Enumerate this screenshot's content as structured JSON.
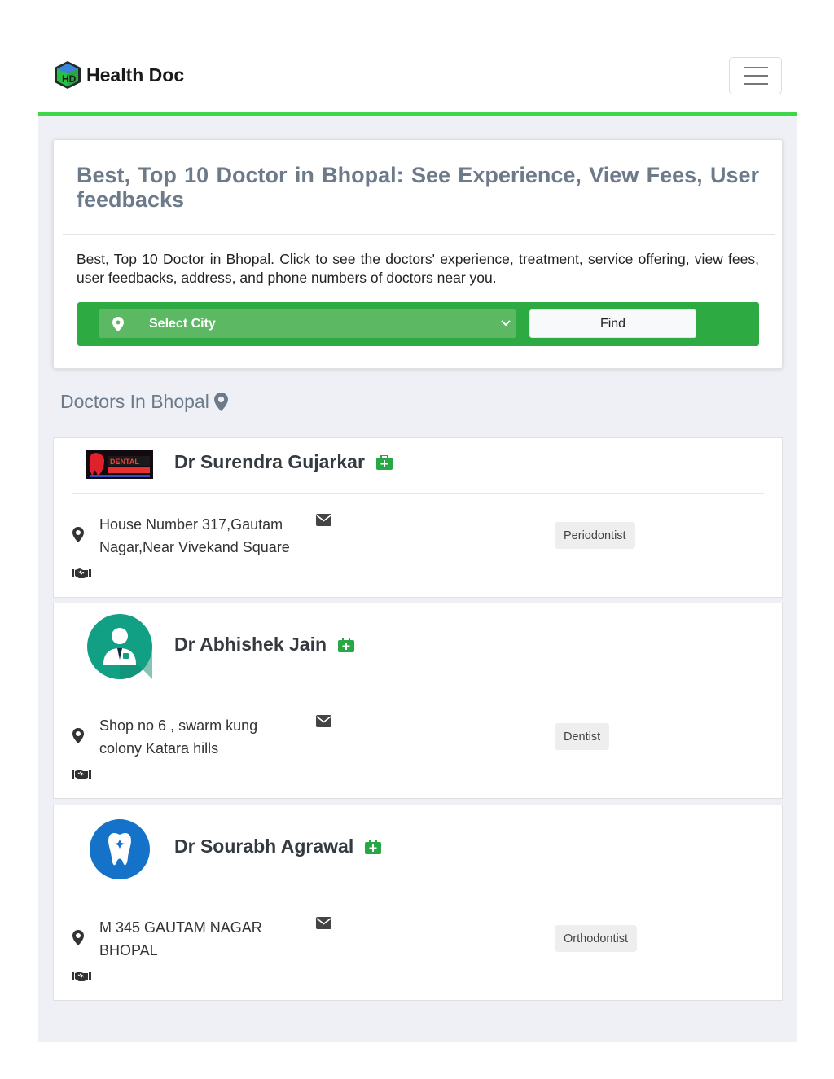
{
  "nav": {
    "brand": "Health Doc",
    "logo_letters": "HD"
  },
  "hero": {
    "title": "Best, Top 10 Doctor in Bhopal: See Experience, View Fees, User feedbacks",
    "description": "Best, Top 10 Doctor in Bhopal. Click to see the doctors' experience, treatment, service offering, view fees, user feedbacks, address, and phone numbers of doctors near you.",
    "city_select": "Select City",
    "find_label": "Find"
  },
  "section_title": "Doctors In Bhopal",
  "doctors": [
    {
      "name": "Dr Surendra Gujarkar",
      "address": "House Number 317,Gautam Nagar,Near Vivekand Square",
      "specialty": "Periodontist",
      "logo_text": "DENTAL"
    },
    {
      "name": "Dr Abhishek Jain",
      "address": "Shop no 6 , swarm kung colony Katara hills",
      "specialty": "Dentist"
    },
    {
      "name": "Dr Sourabh Agrawal",
      "address": "M 345 GAUTAM NAGAR BHOPAL",
      "specialty": "Orthodontist"
    }
  ],
  "colors": {
    "accent_green": "#2eaa43",
    "nav_line": "#3fd64a",
    "kit_green": "#28a745"
  }
}
